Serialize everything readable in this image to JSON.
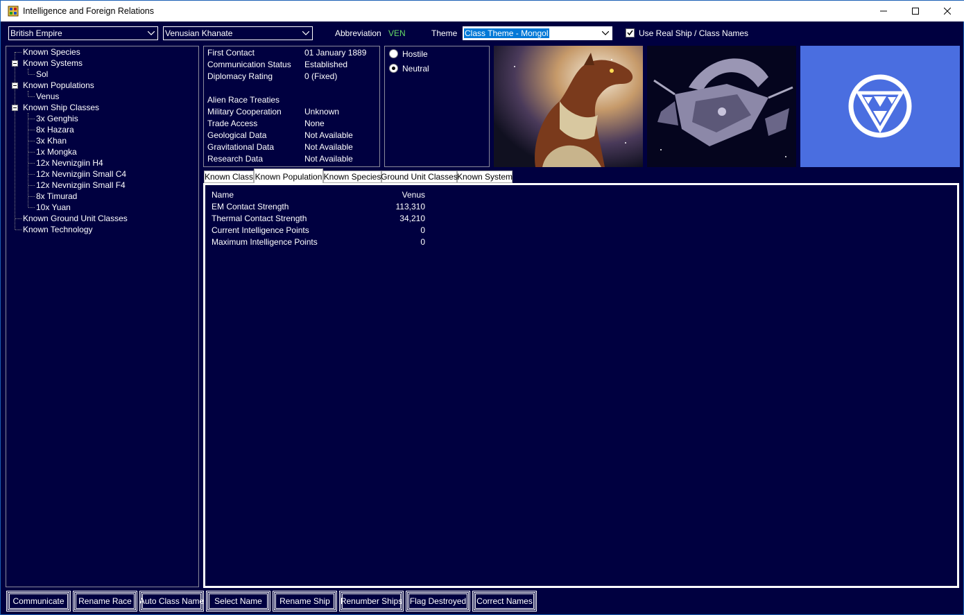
{
  "window": {
    "title": "Intelligence and Foreign Relations"
  },
  "top": {
    "player_race": "British Empire",
    "alien_race": "Venusian Khanate",
    "abbreviation_label": "Abbreviation",
    "abbreviation_value": "VEN",
    "theme_label": "Theme",
    "theme_value": "Class Theme - Mongol",
    "real_names_label": "Use Real Ship / Class Names",
    "real_names_checked": true
  },
  "tree": {
    "known_species": "Known Species",
    "known_systems": "Known Systems",
    "system_sol": "Sol",
    "known_populations": "Known Populations",
    "pop_venus": "Venus",
    "known_ship_classes": "Known Ship Classes",
    "classes": [
      "3x Genghis",
      "8x Hazara",
      "3x Khan",
      "1x Mongka",
      "12x Nevnizgiin H4",
      "12x Nevnizgiin Small C4",
      "12x Nevnizgiin Small F4",
      "8x Timurad",
      "10x Yuan"
    ],
    "known_ground_unit_classes": "Known Ground Unit Classes",
    "known_technology": "Known Technology"
  },
  "info": {
    "first_contact_label": "First Contact",
    "first_contact_value": "01 January 1889",
    "comm_status_label": "Communication Status",
    "comm_status_value": "Established",
    "diplomacy_label": "Diplomacy Rating",
    "diplomacy_value": "0  (Fixed)",
    "treaties_label": "Alien Race Treaties",
    "military_label": "Military Cooperation",
    "military_value": "Unknown",
    "trade_label": "Trade Access",
    "trade_value": "None",
    "geo_label": "Geological Data",
    "geo_value": "Not Available",
    "grav_label": "Gravitational Data",
    "grav_value": "Not Available",
    "research_label": "Research Data",
    "research_value": "Not Available"
  },
  "stance": {
    "hostile": "Hostile",
    "neutral": "Neutral",
    "selected": "Neutral"
  },
  "tabs": [
    "Known Class",
    "Known Population",
    "Known Species",
    "Ground Unit Classes",
    "Known System"
  ],
  "active_tab": "Known Population",
  "population": {
    "rows": [
      {
        "label": "Name",
        "value": "Venus"
      },
      {
        "label": "EM Contact Strength",
        "value": "113,310"
      },
      {
        "label": "Thermal Contact Strength",
        "value": "34,210"
      },
      {
        "label": "Current Intelligence Points",
        "value": "0"
      },
      {
        "label": "Maximum Intelligence Points",
        "value": "0"
      }
    ]
  },
  "buttons": [
    "Communicate",
    "Rename Race",
    "Auto Class Name",
    "Select Name",
    "Rename Ship",
    "Renumber Ships",
    "Flag Destroyed",
    "Correct Names"
  ],
  "colors": {
    "background": "#000040",
    "flag_bg": "#4a6ee0",
    "selection": "#0078d7"
  }
}
